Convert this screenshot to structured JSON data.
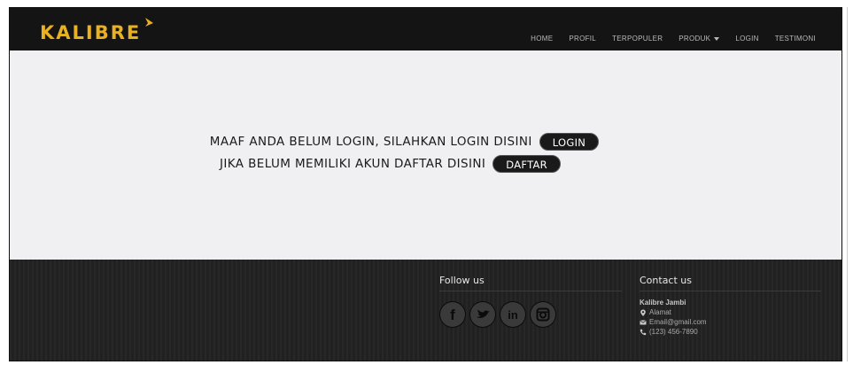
{
  "navbar": {
    "brand": "KALIBRE",
    "brand_color": "#e9b11f",
    "menu": [
      {
        "label": "HOME"
      },
      {
        "label": "PROFIL"
      },
      {
        "label": "TERPOPULER"
      },
      {
        "label": "PRODUK",
        "dropdown": true
      },
      {
        "label": "LOGIN"
      },
      {
        "label": "TESTIMONI"
      }
    ]
  },
  "main": {
    "login_message": "MAAF ANDA BELUM LOGIN, SILAHKAN LOGIN DISINI",
    "login_button": "LOGIN",
    "register_message": "JIKA BELUM MEMILIKI AKUN DAFTAR DISINI",
    "register_button": "DAFTAR"
  },
  "footer": {
    "follow_heading": "Follow us",
    "social_icons": [
      "facebook-icon",
      "twitter-icon",
      "linkedin-icon",
      "instagram-icon"
    ],
    "contact_heading": "Contact us",
    "contact_name": "Kalibre Jambi",
    "address": "Alamat",
    "email": "Email@gmail.com",
    "phone": "(123) 456-7890"
  }
}
